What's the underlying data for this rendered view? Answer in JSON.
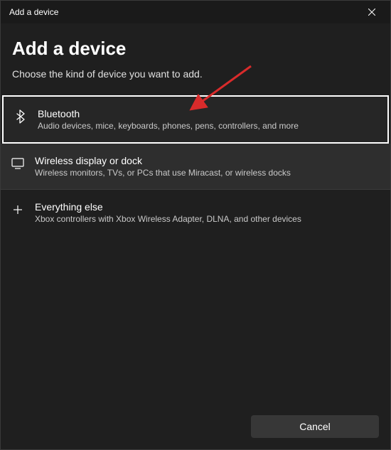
{
  "titleBar": {
    "text": "Add a device"
  },
  "heading": "Add a device",
  "subheading": "Choose the kind of device you want to add.",
  "options": [
    {
      "title": "Bluetooth",
      "description": "Audio devices, mice, keyboards, phones, pens, controllers, and more"
    },
    {
      "title": "Wireless display or dock",
      "description": "Wireless monitors, TVs, or PCs that use Miracast, or wireless docks"
    },
    {
      "title": "Everything else",
      "description": "Xbox controllers with Xbox Wireless Adapter, DLNA, and other devices"
    }
  ],
  "footer": {
    "cancelLabel": "Cancel"
  },
  "annotation": {
    "arrowColor": "#d92b2b"
  }
}
